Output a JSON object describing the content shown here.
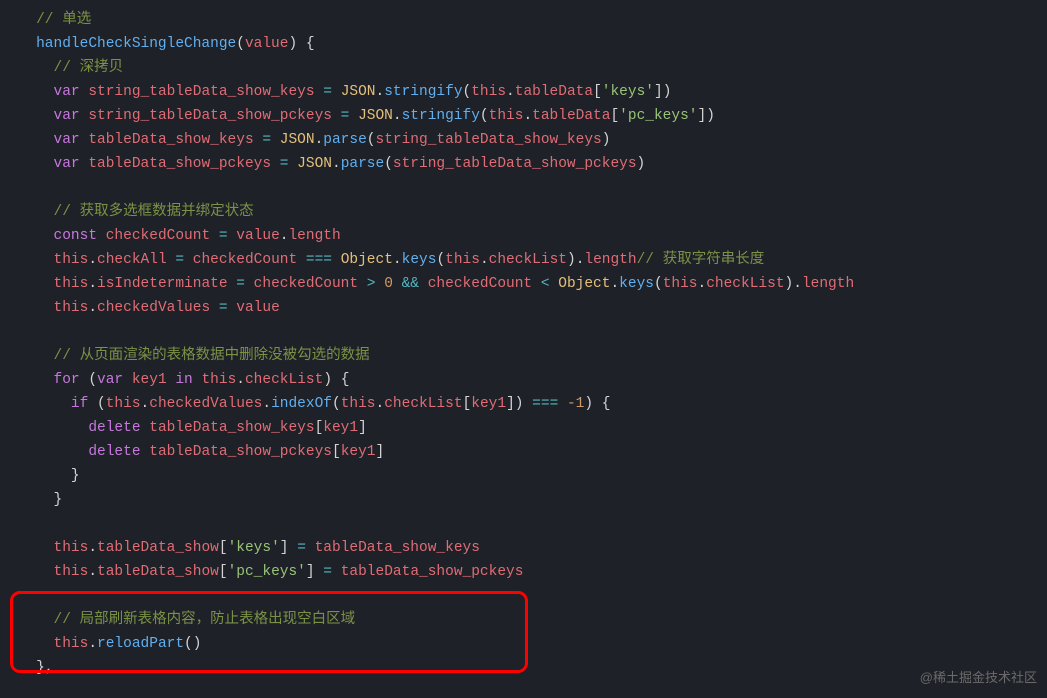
{
  "code": {
    "c1": "// 单选",
    "fn": "handleCheckSingleChange",
    "param": "value",
    "c2": "// 深拷贝",
    "v_var": "var",
    "v1": "string_tableData_show_keys",
    "json": "JSON",
    "stringify": "stringify",
    "this": "this",
    "tableData": "tableData",
    "s_keys": "'keys'",
    "v2": "string_tableData_show_pckeys",
    "s_pckeys": "'pc_keys'",
    "v3": "tableData_show_keys",
    "parse": "parse",
    "v4": "tableData_show_pckeys",
    "c3": "// 获取多选框数据并绑定状态",
    "const": "const",
    "checkedCount": "checkedCount",
    "value": "value",
    "length": "length",
    "checkAll": "checkAll",
    "object": "Object",
    "keys_m": "keys",
    "checkList": "checkList",
    "c4": "// 获取字符串长度",
    "isIndeterminate": "isIndeterminate",
    "zero": "0",
    "checkedValues": "checkedValues",
    "c5": "// 从页面渲染的表格数据中删除没被勾选的数据",
    "for": "for",
    "key1": "key1",
    "in": "in",
    "if": "if",
    "indexOf": "indexOf",
    "neg1": "-1",
    "delete": "delete",
    "tableData_show": "tableData_show",
    "c6": "// 局部刷新表格内容，防止表格出现空白区域",
    "reloadPart": "reloadPart"
  },
  "watermark": "@稀土掘金技术社区"
}
